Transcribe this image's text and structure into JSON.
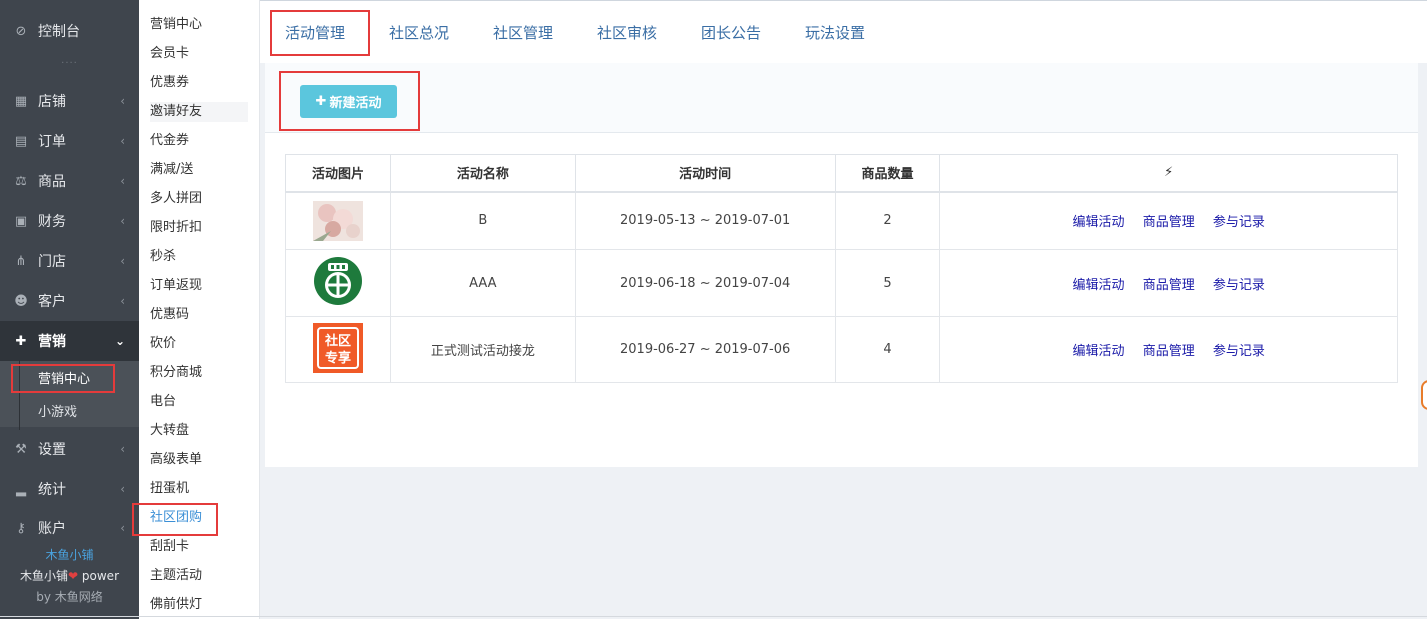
{
  "sidebar": {
    "console": "控制台",
    "dots": "····",
    "items": [
      {
        "label": "店铺",
        "icon": "store-icon"
      },
      {
        "label": "订单",
        "icon": "order-icon"
      },
      {
        "label": "商品",
        "icon": "scale-icon"
      },
      {
        "label": "财务",
        "icon": "money-icon"
      },
      {
        "label": "门店",
        "icon": "sitemap-icon"
      },
      {
        "label": "客户",
        "icon": "users-icon"
      },
      {
        "label": "营销",
        "icon": "gift-icon"
      },
      {
        "label": "设置",
        "icon": "wrench-icon"
      },
      {
        "label": "统计",
        "icon": "signal-icon"
      },
      {
        "label": "账户",
        "icon": "key-icon"
      }
    ],
    "sub_items": [
      "营销中心",
      "小游戏"
    ],
    "brand": "木鱼小铺",
    "power_prefix": "木鱼小铺",
    "power_suffix": "power",
    "byline": "by 木鱼网络"
  },
  "submenu": {
    "items": [
      "营销中心",
      "会员卡",
      "优惠券",
      "邀请好友",
      "代金券",
      "满减/送",
      "多人拼团",
      "限时折扣",
      "秒杀",
      "订单返现",
      "优惠码",
      "砍价",
      "积分商城",
      "电台",
      "大转盘",
      "高级表单",
      "扭蛋机",
      "社区团购",
      "刮刮卡",
      "主题活动",
      "佛前供灯"
    ]
  },
  "tabs": [
    "活动管理",
    "社区总况",
    "社区管理",
    "社区审核",
    "团长公告",
    "玩法设置"
  ],
  "toolbar": {
    "new_button": "新建活动"
  },
  "table": {
    "headers": [
      "活动图片",
      "活动名称",
      "活动时间",
      "商品数量",
      "⚡"
    ],
    "rows": [
      {
        "name": "B",
        "time": "2019-05-13 ~ 2019-07-01",
        "count": "2"
      },
      {
        "name": "AAA",
        "time": "2019-06-18 ~ 2019-07-04",
        "count": "5"
      },
      {
        "name": "正式测试活动接龙",
        "time": "2019-06-27 ~ 2019-07-06",
        "count": "4"
      }
    ],
    "ops": [
      "编辑活动",
      "商品管理",
      "参与记录"
    ],
    "thumb_text": [
      "社区",
      "专享"
    ]
  },
  "colors": {
    "sidebar_bg": "#3f454d",
    "accent": "#5bc6dd",
    "link": "#1a1aa8",
    "highlight": "#e43b3b"
  }
}
